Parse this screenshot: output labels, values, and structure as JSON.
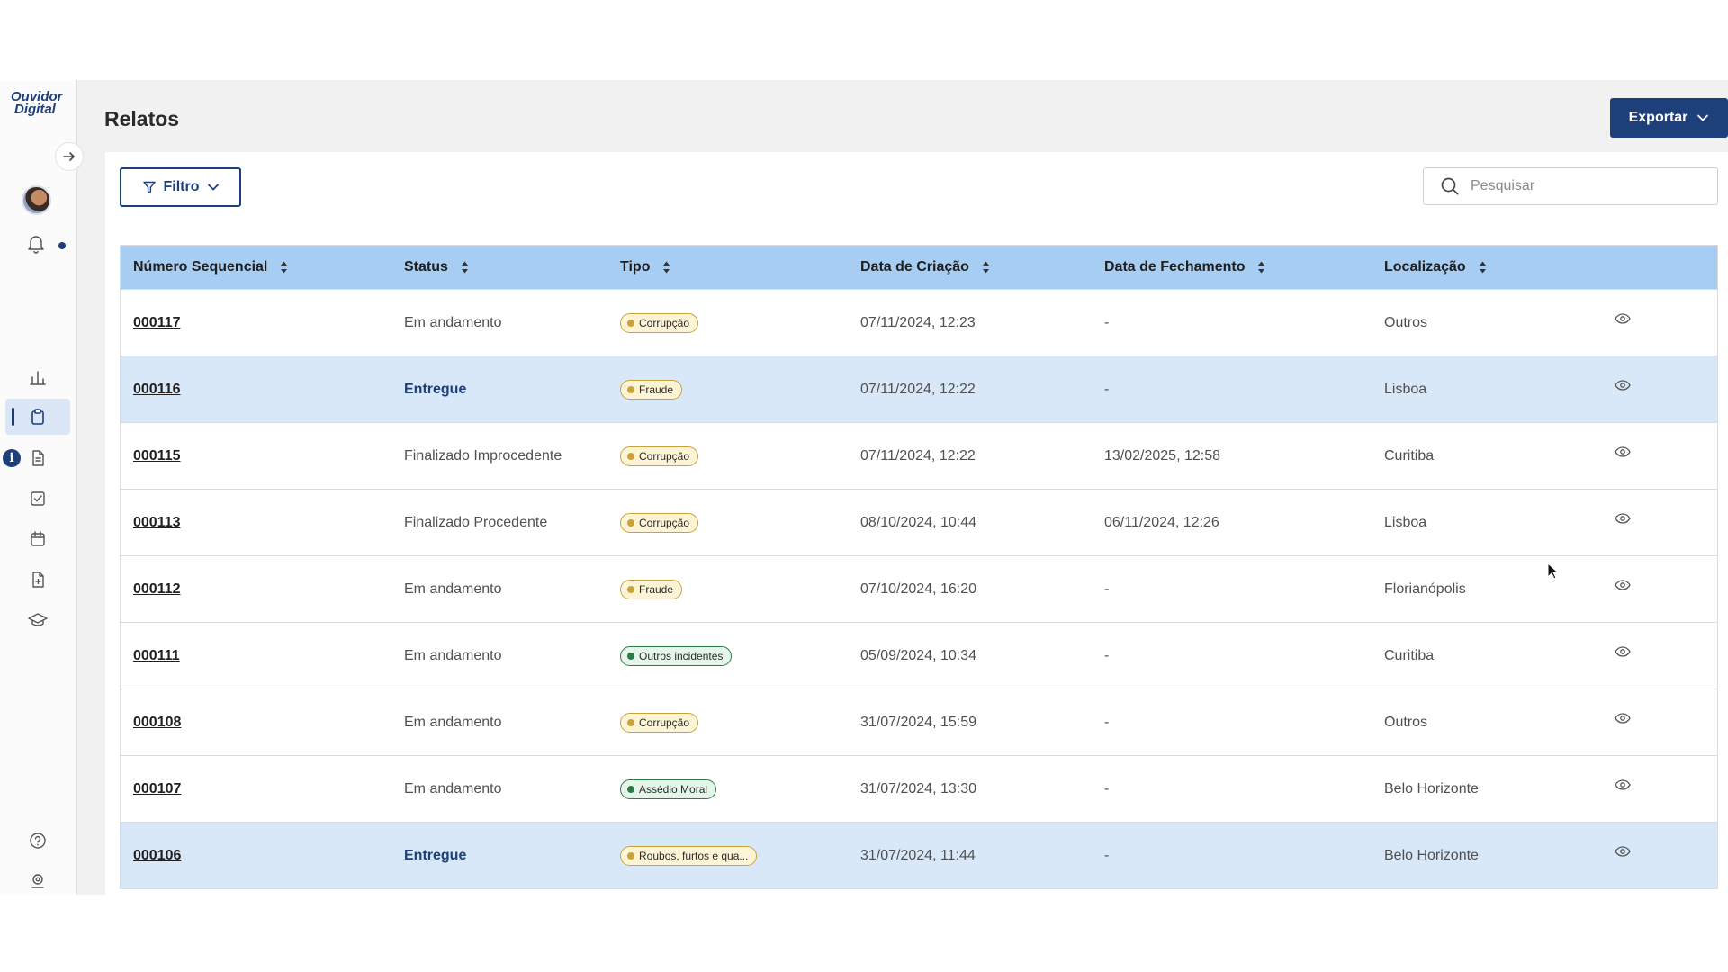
{
  "sidebar": {
    "logo_line1": "Ouvidor",
    "logo_line2": "Digital",
    "info_glyph": "i",
    "icons": [
      "arrow-right-icon",
      "avatar",
      "bell-icon",
      "bar-chart-icon",
      "clipboard-icon",
      "document-icon",
      "checkbox-icon",
      "calendar-icon",
      "file-plus-icon",
      "graduation-cap-icon",
      "help-icon",
      "location-pin-icon"
    ]
  },
  "header": {
    "title": "Relatos",
    "export_label": "Exportar"
  },
  "toolbar": {
    "filter_label": "Filtro",
    "search_placeholder": "Pesquisar"
  },
  "table": {
    "columns": [
      "Número Sequencial",
      "Status",
      "Tipo",
      "Data de Criação",
      "Data de Fechamento",
      "Localização"
    ],
    "rows": [
      {
        "num": "000117",
        "status": "Em andamento",
        "tipo": "Corrupção",
        "tipo_color": "yellow",
        "criacao": "07/11/2024, 12:23",
        "fechamento": "-",
        "local": "Outros",
        "highlight": false
      },
      {
        "num": "000116",
        "status": "Entregue",
        "tipo": "Fraude",
        "tipo_color": "yellow",
        "criacao": "07/11/2024, 12:22",
        "fechamento": "-",
        "local": "Lisboa",
        "highlight": true
      },
      {
        "num": "000115",
        "status": "Finalizado Improcedente",
        "tipo": "Corrupção",
        "tipo_color": "yellow",
        "criacao": "07/11/2024, 12:22",
        "fechamento": "13/02/2025, 12:58",
        "local": "Curitiba",
        "highlight": false
      },
      {
        "num": "000113",
        "status": "Finalizado Procedente",
        "tipo": "Corrupção",
        "tipo_color": "yellow",
        "criacao": "08/10/2024, 10:44",
        "fechamento": "06/11/2024, 12:26",
        "local": "Lisboa",
        "highlight": false
      },
      {
        "num": "000112",
        "status": "Em andamento",
        "tipo": "Fraude",
        "tipo_color": "yellow",
        "criacao": "07/10/2024, 16:20",
        "fechamento": "-",
        "local": "Florianópolis",
        "highlight": false
      },
      {
        "num": "000111",
        "status": "Em andamento",
        "tipo": "Outros incidentes",
        "tipo_color": "green",
        "criacao": "05/09/2024, 10:34",
        "fechamento": "-",
        "local": "Curitiba",
        "highlight": false
      },
      {
        "num": "000108",
        "status": "Em andamento",
        "tipo": "Corrupção",
        "tipo_color": "yellow",
        "criacao": "31/07/2024, 15:59",
        "fechamento": "-",
        "local": "Outros",
        "highlight": false
      },
      {
        "num": "000107",
        "status": "Em andamento",
        "tipo": "Assédio Moral",
        "tipo_color": "green",
        "criacao": "31/07/2024, 13:30",
        "fechamento": "-",
        "local": "Belo Horizonte",
        "highlight": false
      },
      {
        "num": "000106",
        "status": "Entregue",
        "tipo": "Roubos, furtos e qua...",
        "tipo_color": "yellow",
        "criacao": "31/07/2024, 11:44",
        "fechamento": "-",
        "local": "Belo Horizonte",
        "highlight": true
      }
    ]
  },
  "colors": {
    "brand": "#1d3f7a",
    "header_row": "#a7cdf3",
    "highlight_row": "#d8e8f8",
    "tag_yellow": "#c9a33a",
    "tag_green": "#2d7a46"
  }
}
